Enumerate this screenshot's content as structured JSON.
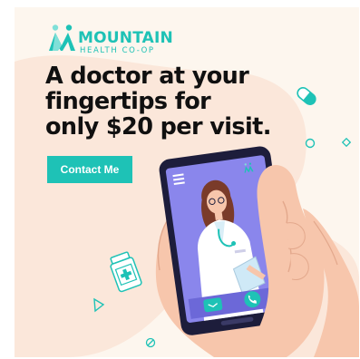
{
  "brand": {
    "name": "MOUNTAIN",
    "tagline": "HEALTH CO-OP",
    "icon": "mountain-people-logo",
    "color": "#1ec2b6"
  },
  "headline": {
    "line1": "A doctor at your",
    "line2": "fingertips for",
    "line3": "only $20 per visit."
  },
  "cta": {
    "label": "Contact Me",
    "color": "#1ec2b6"
  },
  "illustration": {
    "icons": [
      "hand-holding-phone",
      "doctor-video-call",
      "phone-call-icon",
      "message-icon",
      "menu-icon",
      "pill-capsule-icon",
      "medicine-bottle-icon"
    ]
  },
  "colors": {
    "background": "#fdf6ee",
    "blob": "#fce7da",
    "phone_screen": "#8a86ec",
    "skin": "#f7c6ac"
  }
}
